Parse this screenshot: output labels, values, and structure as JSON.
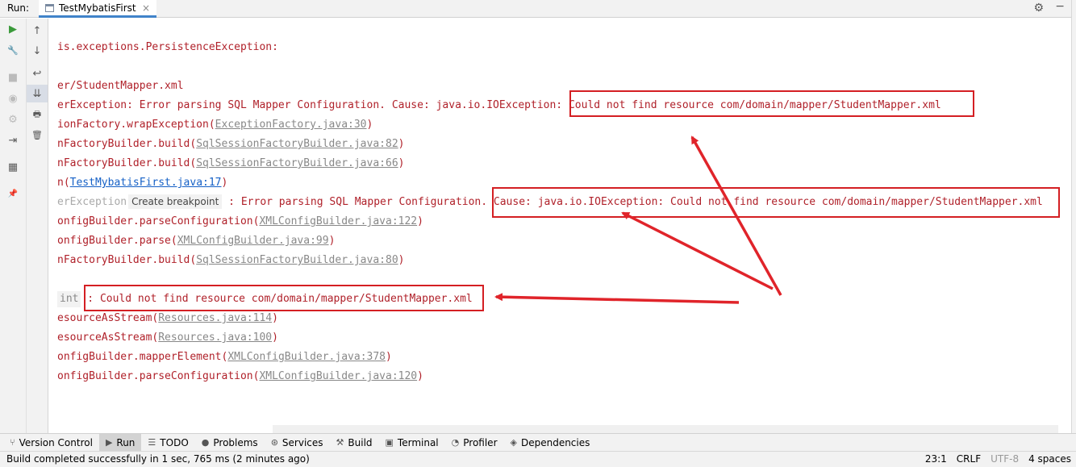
{
  "run_header": {
    "label": "Run:",
    "tab_title": "TestMybatisFirst",
    "tab_close": "×",
    "gear_icon": "⚙",
    "minimize_icon": "−"
  },
  "toolstrip_left": [
    {
      "name": "rerun-icon",
      "glyph": "▶",
      "color": "#3a9a3a"
    },
    {
      "name": "wrench-icon",
      "glyph": "🔧",
      "color": "#555"
    },
    {
      "name": "stop-icon",
      "glyph": "■",
      "color": "#bbbbbb"
    },
    {
      "name": "camera-icon",
      "glyph": "◉",
      "color": "#bbbbbb"
    },
    {
      "name": "settings-icon",
      "glyph": "⚙",
      "color": "#bbbbbb"
    },
    {
      "name": "exit-icon",
      "glyph": "⇥",
      "color": "#777"
    },
    {
      "name": "layout-icon",
      "glyph": "▦",
      "color": "#555"
    },
    {
      "name": "pin-icon",
      "glyph": "📌",
      "color": "#555"
    }
  ],
  "toolstrip_right": [
    {
      "name": "up-arrow-icon",
      "glyph": "↑"
    },
    {
      "name": "down-arrow-icon",
      "glyph": "↓"
    },
    {
      "name": "soft-wrap-icon",
      "glyph": "↩"
    },
    {
      "name": "scroll-to-end-icon",
      "glyph": "⇊"
    },
    {
      "name": "print-icon",
      "glyph": "🖶"
    },
    {
      "name": "trash-icon",
      "glyph": "🗑"
    }
  ],
  "console": {
    "l1": "is.exceptions.PersistenceException:",
    "l2": "er/StudentMapper.xml",
    "l3a": "erException: Error parsing SQL Mapper Configuration. Cause: java.io.IOException: ",
    "l3b": "Could not find resource com/domain/mapper/StudentMapper.xml",
    "l4a": "ionFactory.wrapException(",
    "l4link": "ExceptionFactory.java:30",
    "l4b": ")",
    "l5a": "nFactoryBuilder.build(",
    "l5link": "SqlSessionFactoryBuilder.java:82",
    "l5b": ")",
    "l6a": "nFactoryBuilder.build(",
    "l6link": "SqlSessionFactoryBuilder.java:66",
    "l6b": ")",
    "l7a": "n(",
    "l7link": "TestMybatisFirst.java:17",
    "l7b": ")",
    "l8dim": "erException",
    "l8popup": "Create breakpoint",
    "l8a": " : Error parsing SQL Mapper Configuration. ",
    "l8b": "Cause: java.io.IOException: Could not find resource com/domain/mapper/StudentMapper.xml",
    "l9a": "onfigBuilder.parseConfiguration(",
    "l9link": "XMLConfigBuilder.java:122",
    "l9b": ")",
    "l10a": "onfigBuilder.parse(",
    "l10link": "XMLConfigBuilder.java:99",
    "l10b": ")",
    "l11a": "nFactoryBuilder.build(",
    "l11link": "SqlSessionFactoryBuilder.java:80",
    "l11b": ")",
    "l12chip": "int",
    "l12a": " : ",
    "l12b": "Could not find resource com/domain/mapper/StudentMapper.xml",
    "l13a": "esourceAsStream(",
    "l13link": "Resources.java:114",
    "l13b": ")",
    "l14a": "esourceAsStream(",
    "l14link": "Resources.java:100",
    "l14b": ")",
    "l15a": "onfigBuilder.mapperElement(",
    "l15link": "XMLConfigBuilder.java:378",
    "l15b": ")",
    "l16a": "onfigBuilder.parseConfiguration(",
    "l16link": "XMLConfigBuilder.java:120",
    "l16b": ")"
  },
  "bottom_tabs": [
    {
      "label": "Version Control",
      "icon": "⑂",
      "active": false
    },
    {
      "label": "Run",
      "icon": "▶",
      "active": true
    },
    {
      "label": "TODO",
      "icon": "☰",
      "active": false
    },
    {
      "label": "Problems",
      "icon": "●",
      "active": false
    },
    {
      "label": "Services",
      "icon": "⊛",
      "active": false
    },
    {
      "label": "Build",
      "icon": "⚒",
      "active": false
    },
    {
      "label": "Terminal",
      "icon": "▣",
      "active": false
    },
    {
      "label": "Profiler",
      "icon": "◔",
      "active": false
    },
    {
      "label": "Dependencies",
      "icon": "◈",
      "active": false
    }
  ],
  "status": {
    "message": "Build completed successfully in 1 sec, 765 ms (2 minutes ago)",
    "position": "23:1",
    "line_sep": "CRLF",
    "encoding": "UTF-8",
    "indent": "4 spaces"
  },
  "colors": {
    "error_text": "#b0212a",
    "link_blue": "#1560c6",
    "annotation_red": "#d41f23"
  }
}
